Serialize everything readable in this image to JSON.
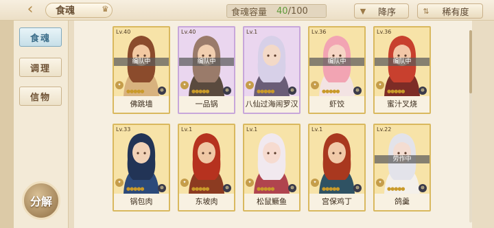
{
  "header": {
    "back_icon": "back-arrow-icon",
    "title": "食魂",
    "crown_icon": "crown-icon",
    "capacity_label": "食魂容量",
    "capacity_current": "40",
    "capacity_sep": "/100",
    "sort_label": "降序",
    "sort_icon": "chevron-down-icon",
    "rarity_label": "稀有度",
    "rarity_icon": "sort-arrows-icon"
  },
  "sidebar": {
    "tabs": [
      {
        "label": "食魂",
        "active": true
      },
      {
        "label": "调理",
        "active": false
      },
      {
        "label": "信物",
        "active": false
      }
    ],
    "decompose_label": "分解"
  },
  "cards": [
    {
      "level": "Lv.40",
      "name": "佛跳墙",
      "badge": "编队中",
      "frame": "gold",
      "skin": "#f3c9a2",
      "hair": "#8b4b2c",
      "cloth": "#d8b27e"
    },
    {
      "level": "Lv.40",
      "name": "一品锅",
      "badge": "编队中",
      "frame": "purple",
      "skin": "#f2cfb0",
      "hair": "#9a7b6a",
      "cloth": "#5a4a3e"
    },
    {
      "level": "Lv.1",
      "name": "八仙过海闹罗汉",
      "badge": "",
      "frame": "purple",
      "skin": "#f3d9c7",
      "hair": "#d7d0e8",
      "cloth": "#6a5d77"
    },
    {
      "level": "Lv.36",
      "name": "虾饺",
      "badge": "编队中",
      "frame": "gold",
      "skin": "#f7d6c6",
      "hair": "#f2a4b3",
      "cloth": "#f3e3e3"
    },
    {
      "level": "Lv.36",
      "name": "蜜汁叉烧",
      "badge": "编队中",
      "frame": "gold",
      "skin": "#f3c7a7",
      "hair": "#c8402e",
      "cloth": "#7d2c26"
    },
    {
      "level": "Lv.33",
      "name": "锅包肉",
      "badge": "",
      "frame": "gold",
      "skin": "#f1d2b7",
      "hair": "#223456",
      "cloth": "#2c4a7a"
    },
    {
      "level": "Lv.1",
      "name": "东坡肉",
      "badge": "",
      "frame": "gold",
      "skin": "#f0c8a5",
      "hair": "#b6321f",
      "cloth": "#8c3b21"
    },
    {
      "level": "Lv.1",
      "name": "松鼠鳜鱼",
      "badge": "",
      "frame": "gold",
      "skin": "#f6dbd0",
      "hair": "#f1e9ef",
      "cloth": "#b0444e"
    },
    {
      "level": "Lv.1",
      "name": "宫保鸡丁",
      "badge": "",
      "frame": "gold",
      "skin": "#f1caa9",
      "hair": "#a9381f",
      "cloth": "#2f5263"
    },
    {
      "level": "Lv.22",
      "name": "鸽羹",
      "badge": "劳作中",
      "frame": "gold",
      "skin": "#f4ddd2",
      "hair": "#e3e3ea",
      "cloth": "#f4f0ea"
    }
  ],
  "colors": {
    "background": "#e9dcc3",
    "accent_gold": "#d9b85e",
    "accent_purple": "#c7a6da",
    "capacity_current": "#5f9a3a",
    "active_tab": "#7da7bd"
  }
}
